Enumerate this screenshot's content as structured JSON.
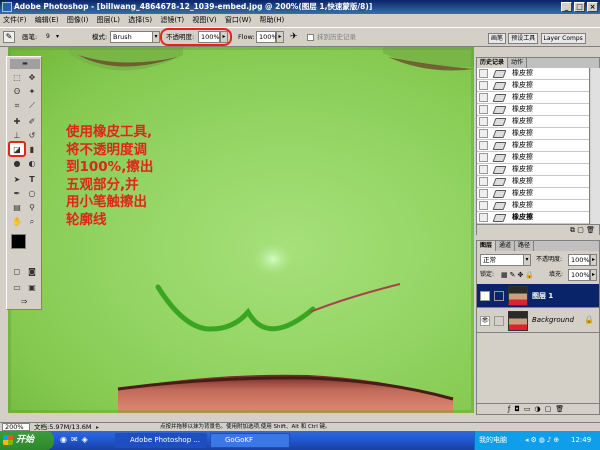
{
  "window": {
    "title": "Adobe Photoshop - [billwang_4864678-12_1039-embed.jpg @ 200%(图层 1,快速蒙版/8)]",
    "controls": [
      "_",
      "□",
      "×"
    ]
  },
  "menu": [
    "文件(F)",
    "编辑(E)",
    "图像(I)",
    "图层(L)",
    "选择(S)",
    "滤镜(T)",
    "视图(V)",
    "窗口(W)",
    "帮助(H)"
  ],
  "options": {
    "brush_label": "画笔:",
    "brush_size": "9",
    "mode_label": "模式:",
    "mode_value": "Brush",
    "opacity_label": "不透明度:",
    "opacity_value": "100%",
    "flow_label": "Flow:",
    "flow_value": "100%",
    "erase_history_label": "抹到历史记录"
  },
  "palette_well": [
    "画笔",
    "预设工具",
    "Layer Comps"
  ],
  "annotation": {
    "lines": [
      "使用橡皮工具,",
      "将不透明度调",
      "到100%,擦出",
      "五观部分,并",
      "用小笔触擦出",
      "轮廓线"
    ],
    "color": "#e3241b"
  },
  "history": {
    "tabs": [
      "历史记录",
      "动作"
    ],
    "items": [
      "橡皮擦",
      "橡皮擦",
      "橡皮擦",
      "橡皮擦",
      "橡皮擦",
      "橡皮擦",
      "橡皮擦",
      "橡皮擦",
      "橡皮擦",
      "橡皮擦",
      "橡皮擦",
      "橡皮擦",
      "橡皮擦"
    ],
    "selected_index": 12
  },
  "layers": {
    "tabs": [
      "图层",
      "通道",
      "路径"
    ],
    "blend_mode": "正常",
    "opacity_label": "不透明度:",
    "opacity_value": "100%",
    "lock_label": "锁定:",
    "fill_label": "填充:",
    "fill_value": "100%",
    "items": [
      {
        "name": "图层 1",
        "visible": true
      },
      {
        "name": "Background",
        "visible": true
      }
    ]
  },
  "status": {
    "zoom": "200%",
    "doc": "文档:5.97M/13.6M",
    "hint": "点按并拖移以抹为背景色。使用附加选项,使用 Shift、Alt 和 Ctrl 键。"
  },
  "taskbar": {
    "start": "开始",
    "tasks": [
      "Adobe Photoshop ...",
      "GoGoKF"
    ],
    "tray_label": "我的电脑",
    "clock": "12:49"
  },
  "colors": {
    "quick_mask_green": "#95d566",
    "annotation_red": "#e3241b",
    "title_blue": "#0a246a"
  }
}
